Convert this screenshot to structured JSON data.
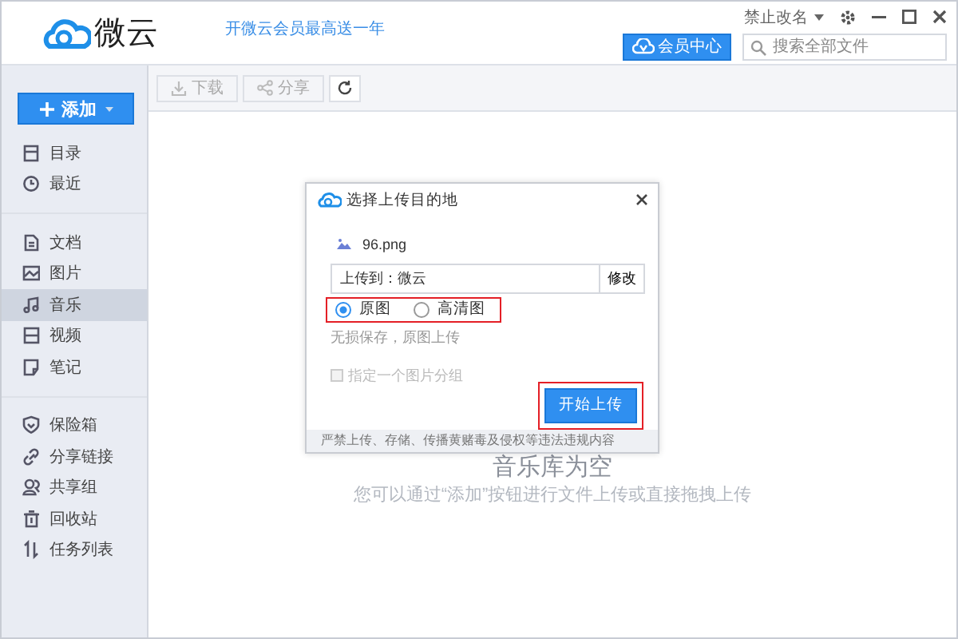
{
  "app": {
    "name": "微云",
    "promo": "开微云会员最高送一年",
    "account": "禁止改名",
    "vip_button": "会员中心",
    "search": {
      "placeholder": "搜索全部文件"
    }
  },
  "sidebar": {
    "add_button": "添加",
    "groups": [
      [
        {
          "label": "目录",
          "selected": false
        },
        {
          "label": "最近",
          "selected": false
        }
      ],
      [
        {
          "label": "文档",
          "selected": false
        },
        {
          "label": "图片",
          "selected": false
        },
        {
          "label": "音乐",
          "selected": true
        },
        {
          "label": "视频",
          "selected": false
        },
        {
          "label": "笔记",
          "selected": false
        }
      ],
      [
        {
          "label": "保险箱",
          "selected": false
        },
        {
          "label": "分享链接",
          "selected": false
        },
        {
          "label": "共享组",
          "selected": false
        },
        {
          "label": "回收站",
          "selected": false
        },
        {
          "label": "任务列表",
          "selected": false
        }
      ]
    ]
  },
  "toolbar": [
    {
      "label": "下载",
      "disabled": true
    },
    {
      "label": "分享",
      "disabled": true
    }
  ],
  "empty_state": {
    "title": "音乐库为空",
    "hint": "您可以通过“添加”按钮进行文件上传或直接拖拽上传"
  },
  "dialog": {
    "title": "选择上传目的地",
    "file": "96.png",
    "destination": "上传到：微云",
    "change_button": "修改",
    "quality_options": [
      {
        "label": "原图",
        "selected": true
      },
      {
        "label": "高清图",
        "selected": false
      }
    ],
    "options_highlighted": true,
    "quality_hint": "无损保存，原图上传",
    "group_option": {
      "label": "指定一个图片分组",
      "checked": false,
      "disabled": true
    },
    "start_button": {
      "label": "开始上传",
      "highlighted": true
    },
    "footer": "严禁上传、存储、传播黄赌毒及侵权等违法违规内容"
  }
}
